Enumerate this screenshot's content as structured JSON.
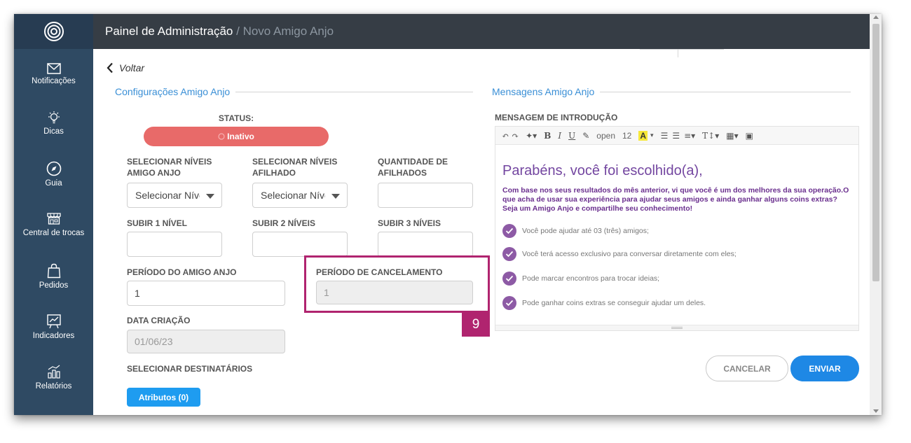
{
  "header": {
    "title": "Painel de Administração",
    "separator": " / ",
    "subtitle": "Novo Amigo Anjo"
  },
  "sidebar": {
    "items": [
      {
        "label": "Notificações",
        "icon": "mail-icon"
      },
      {
        "label": "Dicas",
        "icon": "lightbulb-icon"
      },
      {
        "label": "Guia",
        "icon": "compass-icon"
      },
      {
        "label": "Central de trocas",
        "icon": "store-icon"
      },
      {
        "label": "Pedidos",
        "icon": "shopping-bag-icon"
      },
      {
        "label": "Indicadores",
        "icon": "chart-board-icon"
      },
      {
        "label": "Relatórios",
        "icon": "bar-chart-icon"
      }
    ]
  },
  "back_label": "Voltar",
  "config": {
    "section_title": "Configurações Amigo Anjo",
    "status_label": "STATUS:",
    "status_value": "Inativo",
    "niveis_amigo_label": "SELECIONAR NÍVEIS AMIGO ANJO",
    "niveis_amigo_value": "Selecionar Níveis",
    "niveis_afilhado_label": "SELECIONAR NÍVEIS AFILHADO",
    "niveis_afilhado_value": "Selecionar Níveis",
    "qtd_afilhados_label": "QUANTIDADE DE AFILHADOS",
    "qtd_afilhados_value": "",
    "subir1_label": "SUBIR 1 NÍVEL",
    "subir1_value": "",
    "subir2_label": "SUBIR 2 NÍVEIS",
    "subir2_value": "",
    "subir3_label": "SUBIR 3 NÍVEIS",
    "subir3_value": "",
    "periodo_label": "PERÍODO DO AMIGO ANJO",
    "periodo_value": "1",
    "cancel_periodo_label": "PERÍODO DE CANCELAMENTO",
    "cancel_periodo_value": "1",
    "data_label": "DATA CRIAÇÃO",
    "data_value": "01/06/23",
    "destinatarios_label": "SELECIONAR DESTINATÁRIOS",
    "atributos_button": "Atributos (0)",
    "callout_number": "9"
  },
  "messages": {
    "section_title": "Mensagens Amigo Anjo",
    "intro_label": "MENSAGEM DE INTRODUÇÃO",
    "toolbar": {
      "font_name": "open",
      "font_size": "12"
    },
    "intro_heading": "Parabéns, você foi escolhido(a),",
    "intro_paragraph": "Com base nos seus resultados do mês anterior, vi que você é um dos melhores da sua operação.O que acha de usar sua experiência para ajudar seus amigos e ainda ganhar alguns coins extras? Seja um Amigo Anjo e compartilhe seu conhecimento!",
    "bullets": [
      "Você pode ajudar até 03 (três) amigos;",
      "Você terá acesso exclusivo para conversar diretamente com eles;",
      "Pode marcar encontros para trocar ideias;",
      "Pode ganhar coins extras se conseguir ajudar um deles."
    ]
  },
  "actions": {
    "cancel_label": "CANCELAR",
    "send_label": "ENVIAR"
  },
  "colors": {
    "sidebar": "#2f4a63",
    "topbar": "#363d45",
    "accent": "#1e88e5",
    "status_inactive": "#e86a69",
    "callout": "#b0246f",
    "intro_text": "#6a2f8e"
  }
}
